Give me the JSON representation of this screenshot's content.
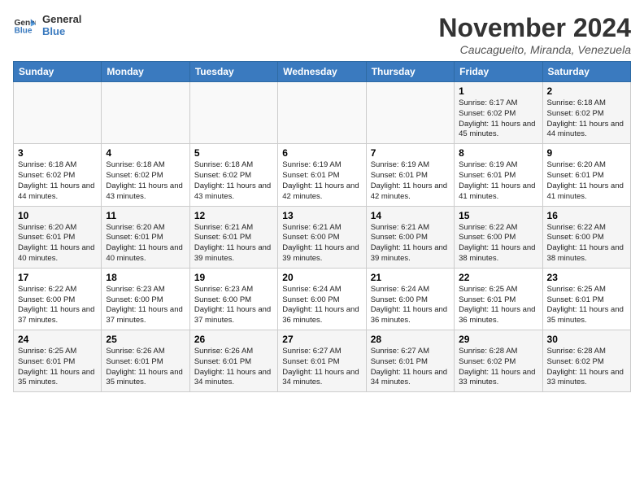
{
  "header": {
    "logo_line1": "General",
    "logo_line2": "Blue",
    "month": "November 2024",
    "location": "Caucagueito, Miranda, Venezuela"
  },
  "weekdays": [
    "Sunday",
    "Monday",
    "Tuesday",
    "Wednesday",
    "Thursday",
    "Friday",
    "Saturday"
  ],
  "weeks": [
    [
      {
        "day": "",
        "info": ""
      },
      {
        "day": "",
        "info": ""
      },
      {
        "day": "",
        "info": ""
      },
      {
        "day": "",
        "info": ""
      },
      {
        "day": "",
        "info": ""
      },
      {
        "day": "1",
        "info": "Sunrise: 6:17 AM\nSunset: 6:02 PM\nDaylight: 11 hours and 45 minutes."
      },
      {
        "day": "2",
        "info": "Sunrise: 6:18 AM\nSunset: 6:02 PM\nDaylight: 11 hours and 44 minutes."
      }
    ],
    [
      {
        "day": "3",
        "info": "Sunrise: 6:18 AM\nSunset: 6:02 PM\nDaylight: 11 hours and 44 minutes."
      },
      {
        "day": "4",
        "info": "Sunrise: 6:18 AM\nSunset: 6:02 PM\nDaylight: 11 hours and 43 minutes."
      },
      {
        "day": "5",
        "info": "Sunrise: 6:18 AM\nSunset: 6:02 PM\nDaylight: 11 hours and 43 minutes."
      },
      {
        "day": "6",
        "info": "Sunrise: 6:19 AM\nSunset: 6:01 PM\nDaylight: 11 hours and 42 minutes."
      },
      {
        "day": "7",
        "info": "Sunrise: 6:19 AM\nSunset: 6:01 PM\nDaylight: 11 hours and 42 minutes."
      },
      {
        "day": "8",
        "info": "Sunrise: 6:19 AM\nSunset: 6:01 PM\nDaylight: 11 hours and 41 minutes."
      },
      {
        "day": "9",
        "info": "Sunrise: 6:20 AM\nSunset: 6:01 PM\nDaylight: 11 hours and 41 minutes."
      }
    ],
    [
      {
        "day": "10",
        "info": "Sunrise: 6:20 AM\nSunset: 6:01 PM\nDaylight: 11 hours and 40 minutes."
      },
      {
        "day": "11",
        "info": "Sunrise: 6:20 AM\nSunset: 6:01 PM\nDaylight: 11 hours and 40 minutes."
      },
      {
        "day": "12",
        "info": "Sunrise: 6:21 AM\nSunset: 6:01 PM\nDaylight: 11 hours and 39 minutes."
      },
      {
        "day": "13",
        "info": "Sunrise: 6:21 AM\nSunset: 6:00 PM\nDaylight: 11 hours and 39 minutes."
      },
      {
        "day": "14",
        "info": "Sunrise: 6:21 AM\nSunset: 6:00 PM\nDaylight: 11 hours and 39 minutes."
      },
      {
        "day": "15",
        "info": "Sunrise: 6:22 AM\nSunset: 6:00 PM\nDaylight: 11 hours and 38 minutes."
      },
      {
        "day": "16",
        "info": "Sunrise: 6:22 AM\nSunset: 6:00 PM\nDaylight: 11 hours and 38 minutes."
      }
    ],
    [
      {
        "day": "17",
        "info": "Sunrise: 6:22 AM\nSunset: 6:00 PM\nDaylight: 11 hours and 37 minutes."
      },
      {
        "day": "18",
        "info": "Sunrise: 6:23 AM\nSunset: 6:00 PM\nDaylight: 11 hours and 37 minutes."
      },
      {
        "day": "19",
        "info": "Sunrise: 6:23 AM\nSunset: 6:00 PM\nDaylight: 11 hours and 37 minutes."
      },
      {
        "day": "20",
        "info": "Sunrise: 6:24 AM\nSunset: 6:00 PM\nDaylight: 11 hours and 36 minutes."
      },
      {
        "day": "21",
        "info": "Sunrise: 6:24 AM\nSunset: 6:00 PM\nDaylight: 11 hours and 36 minutes."
      },
      {
        "day": "22",
        "info": "Sunrise: 6:25 AM\nSunset: 6:01 PM\nDaylight: 11 hours and 36 minutes."
      },
      {
        "day": "23",
        "info": "Sunrise: 6:25 AM\nSunset: 6:01 PM\nDaylight: 11 hours and 35 minutes."
      }
    ],
    [
      {
        "day": "24",
        "info": "Sunrise: 6:25 AM\nSunset: 6:01 PM\nDaylight: 11 hours and 35 minutes."
      },
      {
        "day": "25",
        "info": "Sunrise: 6:26 AM\nSunset: 6:01 PM\nDaylight: 11 hours and 35 minutes."
      },
      {
        "day": "26",
        "info": "Sunrise: 6:26 AM\nSunset: 6:01 PM\nDaylight: 11 hours and 34 minutes."
      },
      {
        "day": "27",
        "info": "Sunrise: 6:27 AM\nSunset: 6:01 PM\nDaylight: 11 hours and 34 minutes."
      },
      {
        "day": "28",
        "info": "Sunrise: 6:27 AM\nSunset: 6:01 PM\nDaylight: 11 hours and 34 minutes."
      },
      {
        "day": "29",
        "info": "Sunrise: 6:28 AM\nSunset: 6:02 PM\nDaylight: 11 hours and 33 minutes."
      },
      {
        "day": "30",
        "info": "Sunrise: 6:28 AM\nSunset: 6:02 PM\nDaylight: 11 hours and 33 minutes."
      }
    ]
  ]
}
